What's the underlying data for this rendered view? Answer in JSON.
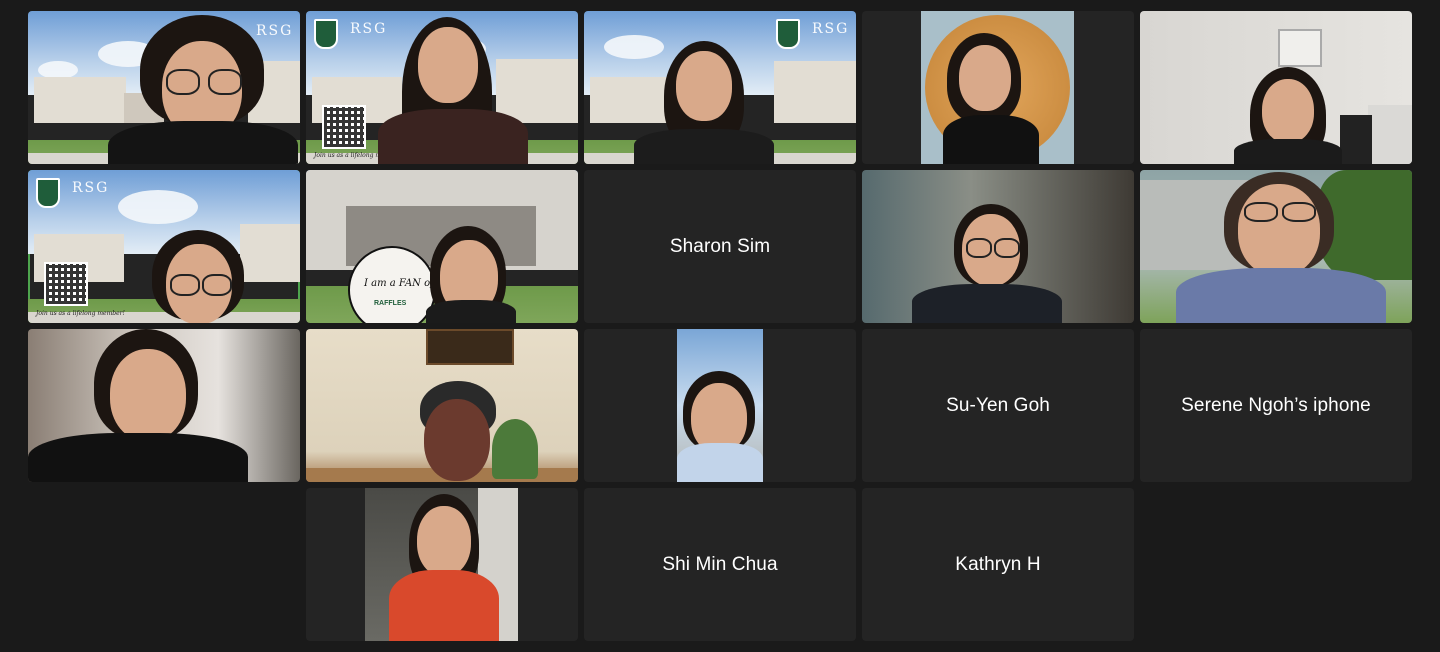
{
  "participants": [
    {
      "id": "p1",
      "type": "video"
    },
    {
      "id": "p2",
      "type": "video"
    },
    {
      "id": "p3",
      "type": "video"
    },
    {
      "id": "p4",
      "type": "video"
    },
    {
      "id": "p5",
      "type": "video"
    },
    {
      "id": "p6",
      "type": "video",
      "active_speaker": true
    },
    {
      "id": "p7",
      "type": "video",
      "sign_text": "I am a FAN of",
      "sign_subtext": "RAFFLES"
    },
    {
      "id": "p8",
      "type": "name",
      "name": "Sharon Sim"
    },
    {
      "id": "p9",
      "type": "video"
    },
    {
      "id": "p10",
      "type": "video"
    },
    {
      "id": "p11",
      "type": "video"
    },
    {
      "id": "p12",
      "type": "video"
    },
    {
      "id": "p13",
      "type": "video"
    },
    {
      "id": "p14",
      "type": "name",
      "name": "Su-Yen Goh"
    },
    {
      "id": "p15",
      "type": "name",
      "name": "Serene Ngoh’s iphone"
    },
    {
      "id": "p16",
      "type": "video"
    },
    {
      "id": "p17",
      "type": "name",
      "name": "Shi Min Chua"
    },
    {
      "id": "p18",
      "type": "name",
      "name": "Kathryn H"
    }
  ],
  "background_logo_text": "RSG",
  "qr_caption": "Join us as a lifelong member!",
  "colors": {
    "background": "#1a1a1a",
    "tile": "#242424",
    "active_speaker_border": "#4ea54e",
    "name_text": "#ffffff"
  }
}
